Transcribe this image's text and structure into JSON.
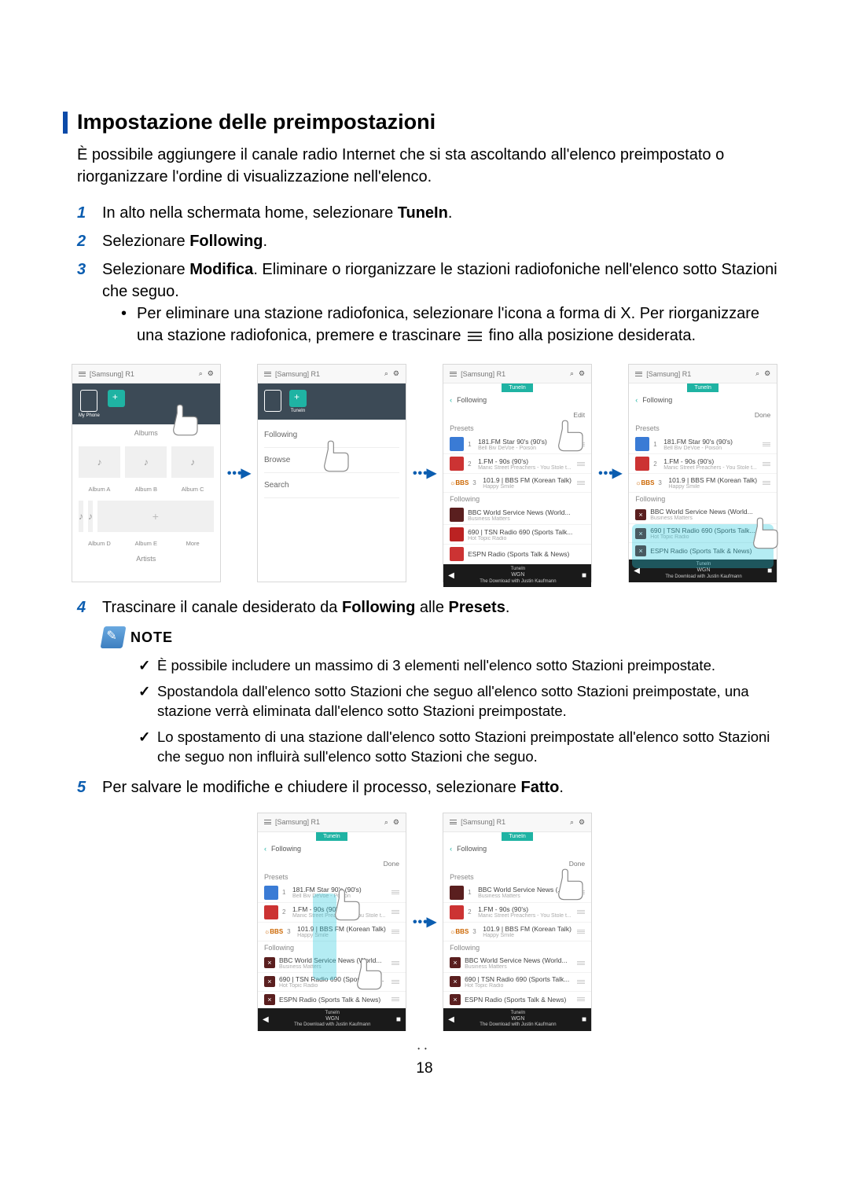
{
  "heading": "Impostazione delle preimpostazioni",
  "intro": "È possibile aggiungere il canale radio Internet che si sta ascoltando all'elenco preimpostato o riorganizzare l'ordine di visualizzazione nell'elenco.",
  "steps": {
    "s1_pre": "In alto nella schermata home, selezionare ",
    "s1_bold": "TuneIn",
    "s1_post": ".",
    "s2_pre": "Selezionare ",
    "s2_bold": "Following",
    "s2_post": ".",
    "s3_pre": "Selezionare ",
    "s3_bold": "Modifica",
    "s3_post": ". Eliminare o riorganizzare le stazioni radiofoniche nell'elenco sotto Stazioni che seguo.",
    "s3_bullet_a": "Per eliminare una stazione radiofonica, selezionare l'icona a forma di X. Per riorganizzare una stazione radiofonica, premere e trascinare ",
    "s3_bullet_b": " fino alla posizione desiderata.",
    "s4_pre": "Trascinare il canale desiderato da ",
    "s4_b1": "Following",
    "s4_mid": " alle ",
    "s4_b2": "Presets",
    "s4_post": ".",
    "s5_pre": "Per salvare le modifiche e chiudere il processo, selezionare ",
    "s5_bold": "Fatto",
    "s5_post": "."
  },
  "note_label": "NOTE",
  "notes": {
    "n1": "È possibile includere un massimo di 3 elementi nell'elenco sotto Stazioni preimpostate.",
    "n2": "Spostandola dall'elenco sotto Stazioni che seguo all'elenco sotto Stazioni preimpostate, una stazione verrà eliminata dall'elenco sotto Stazioni preimpostate.",
    "n3": "Lo spostamento di una stazione dall'elenco sotto Stazioni preimpostate all'elenco sotto Stazioni che seguo non influirà sull'elenco sotto Stazioni che seguo."
  },
  "page_number": "18",
  "shot": {
    "device": "[Samsung] R1",
    "myphone": "My Phone",
    "albums": "Albums",
    "artists": "Artists",
    "album_labels": [
      "Album A",
      "Album B",
      "Album C",
      "Album D",
      "Album E",
      "More"
    ],
    "following": "Following",
    "browse": "Browse",
    "search": "Search",
    "tunein": "TuneIn",
    "edit": "Edit",
    "done": "Done",
    "presets": "Presets",
    "presets_items": [
      {
        "n": "1",
        "title": "181.FM Star 90's (90's)",
        "sub": "Bell Biv DeVoe - Poison"
      },
      {
        "n": "2",
        "title": "1.FM - 90s (90's)",
        "sub": "Manic Street Preachers - You Stole t..."
      },
      {
        "n": "3",
        "title": "101.9 | BBS FM (Korean Talk)",
        "sub": "Happy Smile"
      }
    ],
    "following_items": [
      {
        "title": "BBC World Service News (World...",
        "sub": "Business Matters"
      },
      {
        "title": "690 | TSN Radio 690 (Sports Talk...",
        "sub": "Hot Topic Radio"
      },
      {
        "title": "ESPN Radio (Sports Talk & News)",
        "sub": ""
      }
    ],
    "alt_presets_items": [
      {
        "n": "1",
        "title": "BBC World Service News (...",
        "sub": "Business Matters"
      },
      {
        "n": "2",
        "title": "1.FM - 90s (90's)",
        "sub": "Manic Street Preachers - You Stole t..."
      },
      {
        "n": "3",
        "title": "101.9 | BBS FM (Korean Talk)",
        "sub": "Happy Smile"
      }
    ],
    "playbar_top": "TuneIn",
    "playbar_mid": "WGN",
    "playbar_sub": "The Download with Justin Kaufmann",
    "cbbs": "BBS"
  }
}
